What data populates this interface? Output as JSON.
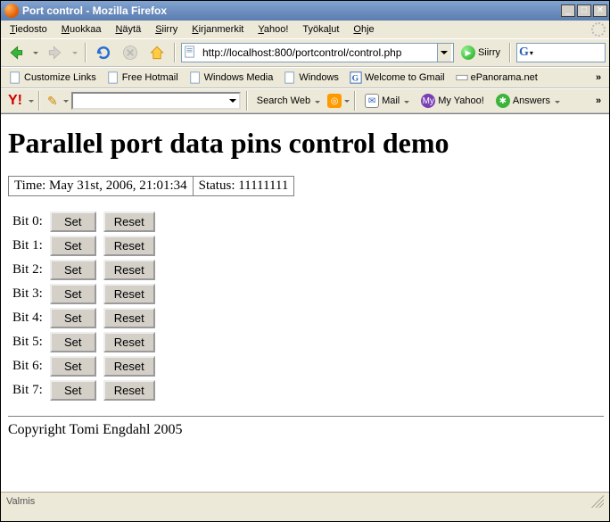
{
  "window": {
    "title": "Port control - Mozilla Firefox"
  },
  "menus": {
    "tiedosto": "Tiedosto",
    "muokkaa": "Muokkaa",
    "nayta": "Näytä",
    "siirry": "Siirry",
    "kirjanmerkit": "Kirjanmerkit",
    "yahoo": "Yahoo!",
    "tyokalut": "Työkalut",
    "ohje": "Ohje"
  },
  "nav": {
    "url": "http://localhost:800/portcontrol/control.php",
    "go_label": "Siirry"
  },
  "bookmarks": {
    "customize": "Customize Links",
    "hotmail": "Free Hotmail",
    "winmedia": "Windows Media",
    "windows": "Windows",
    "gmail": "Welcome to Gmail",
    "epanorama": "ePanorama.net",
    "overflow": "»"
  },
  "yahoo_bar": {
    "logo": "Y!",
    "search_web": "Search Web",
    "mail": "Mail",
    "my_yahoo": "My Yahoo!",
    "answers": "Answers",
    "overflow": "»"
  },
  "page": {
    "heading": "Parallel port data pins control demo",
    "time_cell": "Time: May 31st, 2006, 21:01:34",
    "status_cell": "Status: 11111111",
    "bits": [
      {
        "label": "Bit 0:",
        "set": "Set",
        "reset": "Reset"
      },
      {
        "label": "Bit 1:",
        "set": "Set",
        "reset": "Reset"
      },
      {
        "label": "Bit 2:",
        "set": "Set",
        "reset": "Reset"
      },
      {
        "label": "Bit 3:",
        "set": "Set",
        "reset": "Reset"
      },
      {
        "label": "Bit 4:",
        "set": "Set",
        "reset": "Reset"
      },
      {
        "label": "Bit 5:",
        "set": "Set",
        "reset": "Reset"
      },
      {
        "label": "Bit 6:",
        "set": "Set",
        "reset": "Reset"
      },
      {
        "label": "Bit 7:",
        "set": "Set",
        "reset": "Reset"
      }
    ],
    "copyright": "Copyright Tomi Engdahl 2005"
  },
  "statusbar": {
    "text": "Valmis"
  }
}
